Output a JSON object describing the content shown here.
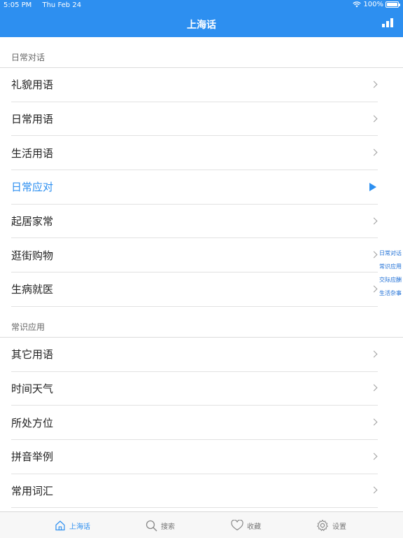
{
  "status": {
    "time": "5:05 PM",
    "date": "Thu Feb 24",
    "battery": "100%",
    "battery_level": 1.0
  },
  "nav": {
    "title": "上海话"
  },
  "sections": [
    {
      "title": "日常对话",
      "items": [
        {
          "label": "礼貌用语",
          "active": false
        },
        {
          "label": "日常用语",
          "active": false
        },
        {
          "label": "生活用语",
          "active": false
        },
        {
          "label": "日常应对",
          "active": true
        },
        {
          "label": "起居家常",
          "active": false
        },
        {
          "label": "逛街购物",
          "active": false
        },
        {
          "label": "生病就医",
          "active": false
        }
      ]
    },
    {
      "title": "常识应用",
      "items": [
        {
          "label": "其它用语",
          "active": false
        },
        {
          "label": "时间天气",
          "active": false
        },
        {
          "label": "所处方位",
          "active": false
        },
        {
          "label": "拼音举例",
          "active": false
        },
        {
          "label": "常用词汇",
          "active": false
        }
      ]
    }
  ],
  "index": [
    "日常对话",
    "常识应用",
    "交际应酬",
    "生活杂事"
  ],
  "tabs": [
    {
      "label": "上海话",
      "icon": "home-icon",
      "active": true
    },
    {
      "label": "搜索",
      "icon": "search-icon",
      "active": false
    },
    {
      "label": "收藏",
      "icon": "heart-icon",
      "active": false
    },
    {
      "label": "设置",
      "icon": "gear-icon",
      "active": false
    }
  ],
  "colors": {
    "accent": "#2d8ff0",
    "text": "#222222",
    "divider": "#e2e2e2"
  }
}
